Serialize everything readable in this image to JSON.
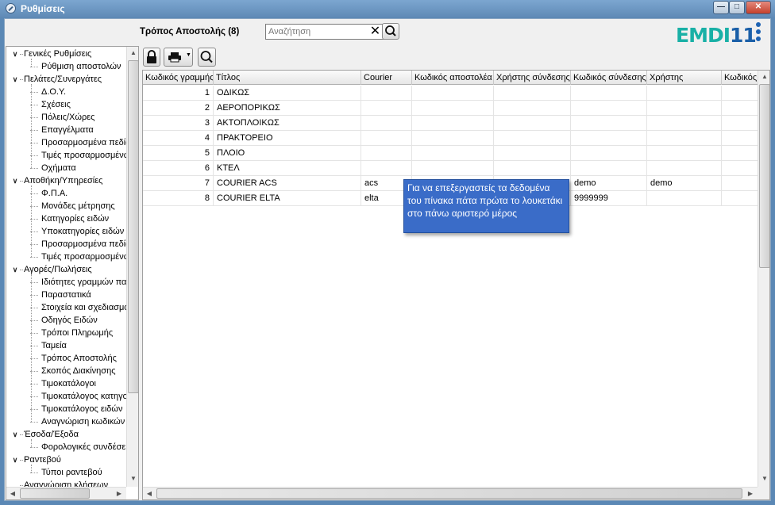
{
  "window": {
    "title": "Ρυθμίσεις"
  },
  "header": {
    "section_title": "Τρόπος Αποστολής (8)",
    "search_placeholder": "Αναζήτηση",
    "logo_part1": "EMDI",
    "logo_part2": "11"
  },
  "tree": {
    "items": [
      {
        "label": "Γενικές Ρυθμίσεις",
        "level": 0
      },
      {
        "label": "Ρύθμιση αποστολών",
        "level": 1
      },
      {
        "label": "Πελάτες/Συνεργάτες",
        "level": 0
      },
      {
        "label": "Δ.Ο.Υ.",
        "level": 1
      },
      {
        "label": "Σχέσεις",
        "level": 1
      },
      {
        "label": "Πόλεις/Χώρες",
        "level": 1
      },
      {
        "label": "Επαγγέλματα",
        "level": 1
      },
      {
        "label": "Προσαρμοσμένα πεδία",
        "level": 1
      },
      {
        "label": "Τιμές προσαρμοσμένων",
        "level": 1
      },
      {
        "label": "Οχήματα",
        "level": 1
      },
      {
        "label": "Αποθήκη/Υπηρεσίες",
        "level": 0
      },
      {
        "label": "Φ.Π.Α.",
        "level": 1
      },
      {
        "label": "Μονάδες μέτρησης",
        "level": 1
      },
      {
        "label": "Κατηγορίες ειδών",
        "level": 1
      },
      {
        "label": "Υποκατηγορίες ειδών",
        "level": 1
      },
      {
        "label": "Προσαρμοσμένα πεδία",
        "level": 1
      },
      {
        "label": "Τιμές προσαρμοσμένων",
        "level": 1
      },
      {
        "label": "Αγορές/Πωλήσεις",
        "level": 0
      },
      {
        "label": "Ιδιότητες γραμμών παραστατικών",
        "level": 1
      },
      {
        "label": "Παραστατικά",
        "level": 1
      },
      {
        "label": "Στοιχεία και σχεδιασμός",
        "level": 1
      },
      {
        "label": "Οδηγός Ειδών",
        "level": 1
      },
      {
        "label": "Τρόποι Πληρωμής",
        "level": 1
      },
      {
        "label": "Ταμεία",
        "level": 1
      },
      {
        "label": "Τρόπος Αποστολής",
        "level": 1
      },
      {
        "label": "Σκοπός Διακίνησης",
        "level": 1
      },
      {
        "label": "Τιμοκατάλογοι",
        "level": 1
      },
      {
        "label": "Τιμοκατάλογος κατηγοριών",
        "level": 1
      },
      {
        "label": "Τιμοκατάλογος ειδών",
        "level": 1
      },
      {
        "label": "Αναγνώριση κωδικών",
        "level": 1
      },
      {
        "label": "Έσοδα/Έξοδα",
        "level": 0
      },
      {
        "label": "Φορολογικές συνδέσεις",
        "level": 1
      },
      {
        "label": "Ραντεβού",
        "level": 0
      },
      {
        "label": "Τύποι ραντεβού",
        "level": 1
      },
      {
        "label": "Αναγνώριση κλήσεων",
        "level": 0
      }
    ]
  },
  "grid": {
    "columns": [
      "Κωδικός γραμμής",
      "Τίτλος",
      "Courier",
      "Κωδικός αποστολέα",
      "Χρήστης σύνδεσης",
      "Κωδικός σύνδεσης",
      "Χρήστης",
      "Κωδικός"
    ],
    "rows": [
      [
        "1",
        "ΟΔΙΚΩΣ",
        "",
        "",
        "",
        "",
        "",
        ""
      ],
      [
        "2",
        "ΑΕΡΟΠΟΡΙΚΩΣ",
        "",
        "",
        "",
        "",
        "",
        ""
      ],
      [
        "3",
        "ΑΚΤΟΠΛΟΙΚΩΣ",
        "",
        "",
        "",
        "",
        "",
        ""
      ],
      [
        "4",
        "ΠΡΑΚΤΟΡΕΙΟ",
        "",
        "",
        "",
        "",
        "",
        ""
      ],
      [
        "5",
        "ΠΛΟΙΟ",
        "",
        "",
        "",
        "",
        "",
        ""
      ],
      [
        "6",
        "ΚΤΕΛ",
        "",
        "",
        "",
        "",
        "",
        ""
      ],
      [
        "7",
        "COURIER ACS",
        "acs",
        "",
        "",
        "demo",
        "demo",
        ""
      ],
      [
        "8",
        "COURIER ELTA",
        "elta",
        "",
        "",
        "9999999",
        "",
        ""
      ]
    ]
  },
  "tooltip": {
    "text": "Για να επεξεργαστείς τα δεδομένα του πίνακα πάτα πρώτα το λουκετάκι στο πάνω αριστερό μέρος"
  },
  "colors": {
    "titlebar": "#6a96c3",
    "tooltip_bg": "#3a6cc8",
    "logo_teal": "#19b0a6",
    "logo_blue": "#1a5fa8"
  }
}
